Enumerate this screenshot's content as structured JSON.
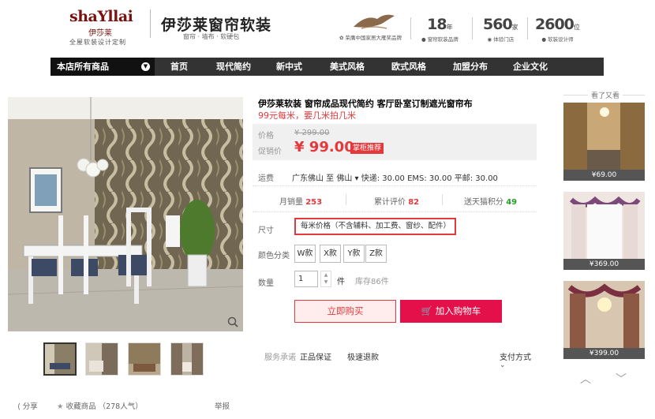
{
  "header": {
    "logo_main": "shaYllai",
    "logo_cn": "伊莎莱",
    "logo_sub": "全屋软装设计定制",
    "brand_title": "伊莎莱窗帘软装",
    "brand_sub": "窗帘 · 墙布 · 软硬包",
    "award_text": "荣膺中国家居大雁奖品牌",
    "stats": [
      {
        "num": "18",
        "unit": "年",
        "label": "窗帘软装品牌"
      },
      {
        "num": "560",
        "unit": "家",
        "label": "体验门店"
      },
      {
        "num": "2600",
        "unit": "位",
        "label": "软装设计师"
      }
    ]
  },
  "nav": {
    "all_label": "本店所有商品",
    "items": [
      "首页",
      "现代简约",
      "新中式",
      "美式风格",
      "欧式风格",
      "加盟分布",
      "企业文化"
    ]
  },
  "product": {
    "title": "伊莎莱软装 窗帘成品现代简约 客厅卧室订制遮光窗帘布",
    "subtitle": "99元每米，要几米拍几米",
    "price_label": "价格",
    "orig_price": "¥ 299.00",
    "promo_label": "促销价",
    "cur_price": "¥ 99.00",
    "promo_tag": "掌柜推荐",
    "ship_label": "运费",
    "ship_text": "广东佛山  至  佛山 ▾  快递: 30.00  EMS: 30.00  平邮: 30.00",
    "monthly_sales_label": "月销量",
    "monthly_sales": "253",
    "reviews_label": "累计评价",
    "reviews": "82",
    "points_label": "送天猫积分",
    "points": "49",
    "size_label": "尺寸",
    "size_value": "每米价格（不含辅料、加工费、窗纱、配件）",
    "color_label": "颜色分类",
    "colors": [
      "W款",
      "X款",
      "Y款",
      "Z款"
    ],
    "qty_label": "数量",
    "qty_value": "1",
    "qty_unit": "件",
    "stock": "库存86件",
    "buy_now": "立即购买",
    "add_cart": "加入购物车",
    "promise_label": "服务承诺",
    "promises": [
      "正品保证",
      "极速退款"
    ],
    "pay_label": "支付方式"
  },
  "footer": {
    "share": "分享",
    "fav": "收藏商品 （278人气）",
    "report": "举报"
  },
  "sidebar": {
    "title": "看了又看",
    "items": [
      {
        "price": "¥69.00"
      },
      {
        "price": "¥369.00"
      },
      {
        "price": "¥399.00"
      }
    ]
  },
  "colors": {
    "accent": "#e4393c",
    "cart": "#e4104a",
    "nav_bg": "#333333",
    "price_bg": "#f0f0f0"
  }
}
